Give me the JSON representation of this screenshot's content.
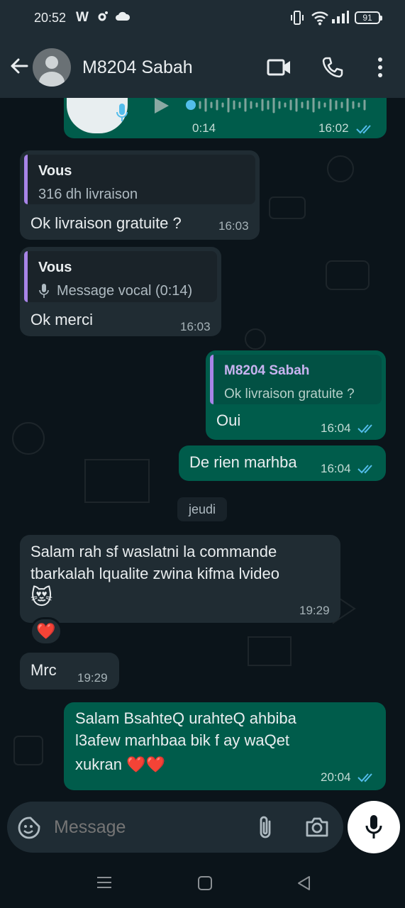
{
  "status_bar": {
    "time": "20:52",
    "app_letter": "W",
    "battery": "91"
  },
  "header": {
    "contact_name": "M8204 Sabah"
  },
  "messages": [
    {
      "type": "voice",
      "direction": "out",
      "duration": "0:14",
      "time": "16:02"
    },
    {
      "type": "reply",
      "direction": "in",
      "quote_author": "Vous",
      "quote_text": "316 dh livraison",
      "text": "Ok livraison gratuite ?",
      "time": "16:03"
    },
    {
      "type": "reply",
      "direction": "in",
      "quote_author": "Vous",
      "quote_text": "Message vocal (0:14)",
      "text": "Ok merci",
      "time": "16:03"
    },
    {
      "type": "reply",
      "direction": "out",
      "quote_author": "M8204 Sabah",
      "quote_text": "Ok livraison gratuite ?",
      "text": "Oui",
      "time": "16:04"
    },
    {
      "type": "text",
      "direction": "out",
      "text": "De rien marhba",
      "time": "16:04"
    },
    {
      "type": "text",
      "direction": "in",
      "line1": "Salam rah sf waslatni la commande",
      "line2": "tbarkalah lqualite zwina kifma lvideo",
      "emoji": "😻",
      "time": "19:29",
      "reaction": "❤️"
    },
    {
      "type": "text",
      "direction": "in",
      "text": "Mrc",
      "time": "19:29"
    },
    {
      "type": "text",
      "direction": "out",
      "line1": "Salam BsahteQ urahteQ ahbiba",
      "line2": "l3afew marhbaa bik f ay waQet",
      "line3": "xukran ❤️❤️",
      "time": "20:04"
    }
  ],
  "day_separator": "jeudi",
  "composer": {
    "placeholder": "Message"
  },
  "colors": {
    "incoming_bubble": "#202c33",
    "outgoing_bubble": "#005c4b",
    "read_ticks": "#53bdeb",
    "quote_accent_in": "#a884e8",
    "quote_accent_out": "#a884e8",
    "background": "#0b141a"
  },
  "icons": [
    "back-arrow-icon",
    "video-call-icon",
    "voice-call-icon",
    "more-options-icon",
    "sticker-icon",
    "attach-icon",
    "camera-icon",
    "mic-icon",
    "play-icon"
  ]
}
